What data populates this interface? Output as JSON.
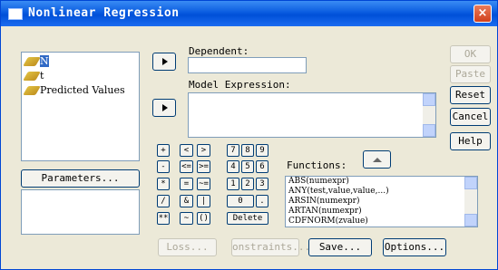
{
  "window": {
    "title": "Nonlinear Regression",
    "close_glyph": "×"
  },
  "variables": [
    "N",
    "t",
    "Predicted Values"
  ],
  "labels": {
    "dependent": "Dependent:",
    "model_expression": "Model Expression:",
    "functions": "Functions:"
  },
  "buttons": {
    "ok": "OK",
    "paste": "Paste",
    "reset": "Reset",
    "cancel": "Cancel",
    "help": "Help",
    "parameters": "Parameters...",
    "loss": "Loss...",
    "constraints": "onstraints...",
    "save": "Save...",
    "options": "Options..."
  },
  "calculator": [
    [
      "+",
      "<",
      ">",
      "7",
      "8",
      "9"
    ],
    [
      "-",
      "<=",
      ">=",
      "4",
      "5",
      "6"
    ],
    [
      "*",
      "=",
      "~=",
      "1",
      "2",
      "3"
    ],
    [
      "/",
      "&",
      "|",
      "0",
      "."
    ],
    [
      "**",
      "~",
      "()",
      "Delete"
    ]
  ],
  "functions": [
    "ABS(numexpr)",
    "ANY(test,value,value,...)",
    "ARSIN(numexpr)",
    "ARTAN(numexpr)",
    "CDFNORM(zvalue)"
  ],
  "icons": {
    "variable_icon": "ruler-icon",
    "move_arrow": "right-arrow-icon",
    "up_arrow": "up-arrow-icon"
  }
}
